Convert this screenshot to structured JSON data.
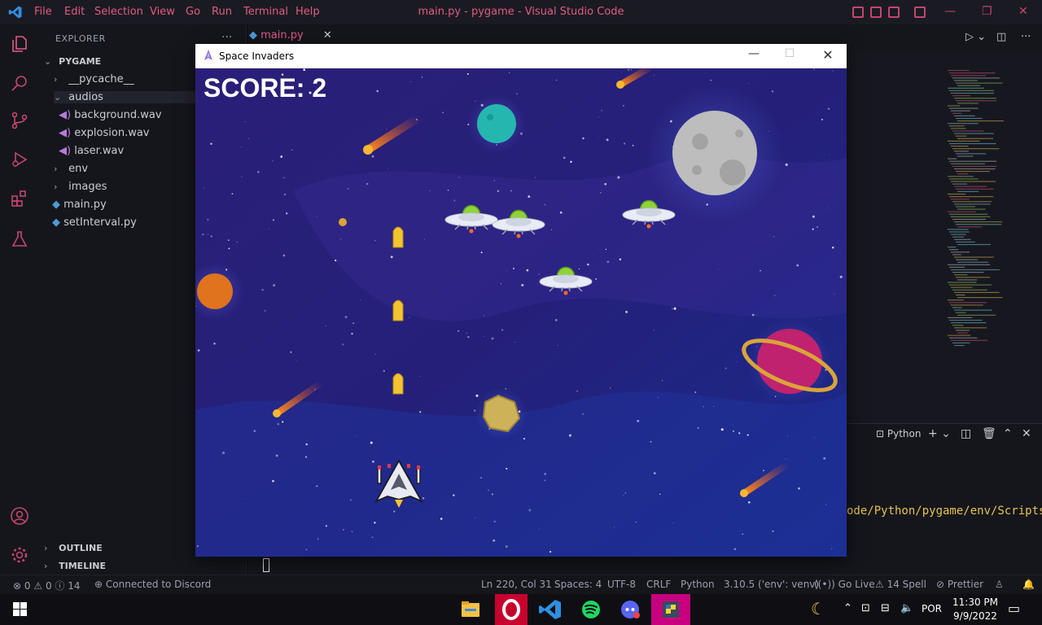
{
  "vscode": {
    "menu": [
      "File",
      "Edit",
      "Selection",
      "View",
      "Go",
      "Run",
      "Terminal",
      "Help"
    ],
    "window_title": "main.py - pygame - Visual Studio Code",
    "explorer": {
      "title": "EXPLORER",
      "project": "PYGAME",
      "items": [
        {
          "label": "__pycache__",
          "type": "folder-closed"
        },
        {
          "label": "audios",
          "type": "folder-open"
        },
        {
          "label": "background.wav",
          "type": "audio"
        },
        {
          "label": "explosion.wav",
          "type": "audio"
        },
        {
          "label": "laser.wav",
          "type": "audio"
        },
        {
          "label": "env",
          "type": "folder-closed"
        },
        {
          "label": "images",
          "type": "folder-closed"
        },
        {
          "label": "main.py",
          "type": "python"
        },
        {
          "label": "setInterval.py",
          "type": "python"
        }
      ],
      "outline": "OUTLINE",
      "timeline": "TIMELINE"
    },
    "tab": {
      "label": "main.py",
      "close": "✕"
    },
    "terminal": {
      "shell_label": "Python",
      "path_line": "ode/Python/pygame/env/Scripts/p"
    },
    "status": {
      "errors": "0",
      "warnings": "0",
      "info": "14",
      "discord": "Connected to Discord",
      "position": "Ln 220, Col 31",
      "spaces": "Spaces: 4",
      "encoding": "UTF-8",
      "eol": "CRLF",
      "language": "Python",
      "interpreter": "3.10.5 ('env': venv)",
      "go_live": "Go Live",
      "spell": "14 Spell",
      "prettier": "Prettier"
    }
  },
  "taskbar": {
    "lang": "POR",
    "time": "11:30 PM",
    "date": "9/9/2022"
  },
  "pygame_window": {
    "title": "Space Invaders",
    "minimize": "—",
    "maximize": "☐",
    "close": "✕",
    "score_text": "SCORE: 2"
  },
  "colors": {
    "accent": "#e05a87",
    "space_dark": "#1e1c6b",
    "space_light": "#3b2d9a"
  }
}
